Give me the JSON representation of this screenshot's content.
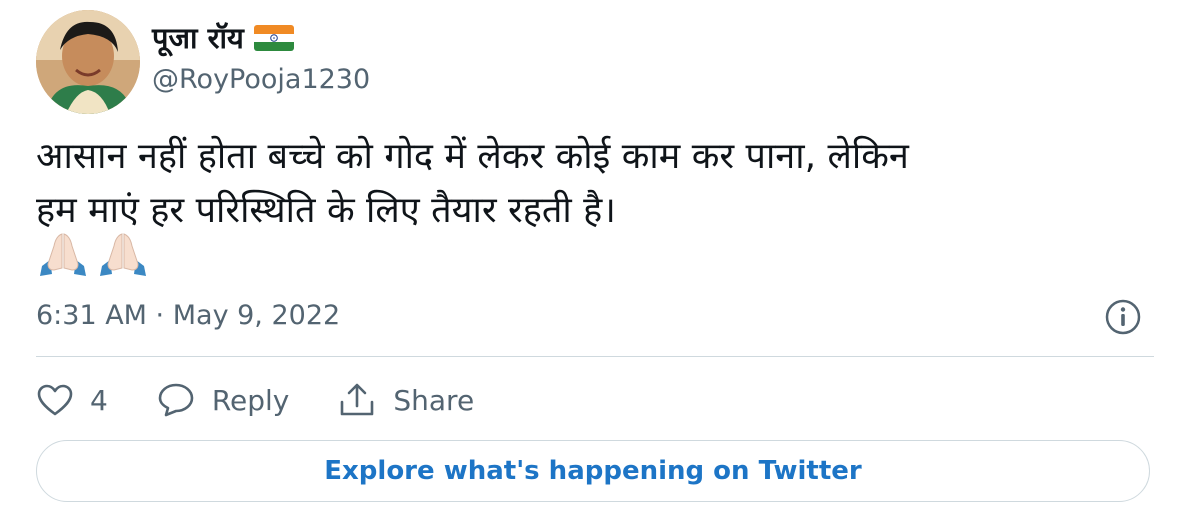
{
  "author": {
    "display_name": "पूजा रॉय",
    "handle": "@RoyPooja1230",
    "flag_icon": "india-flag-icon"
  },
  "tweet": {
    "text_line1": "आसान नहीं होता बच्चे को गोद में लेकर कोई काम कर पाना, लेकिन",
    "text_line2": "हम माएं हर परिस्थिति के लिए तैयार रहती है।",
    "emojis": [
      "folded-hands-icon",
      "folded-hands-icon"
    ],
    "timestamp": "6:31 AM · May 9, 2022"
  },
  "actions": {
    "like_count": "4",
    "reply_label": "Reply",
    "share_label": "Share"
  },
  "explore": {
    "label": "Explore what's happening on Twitter"
  },
  "colors": {
    "accent": "#1d75c6",
    "secondary_text": "#536471",
    "divider": "#cfd9de"
  }
}
